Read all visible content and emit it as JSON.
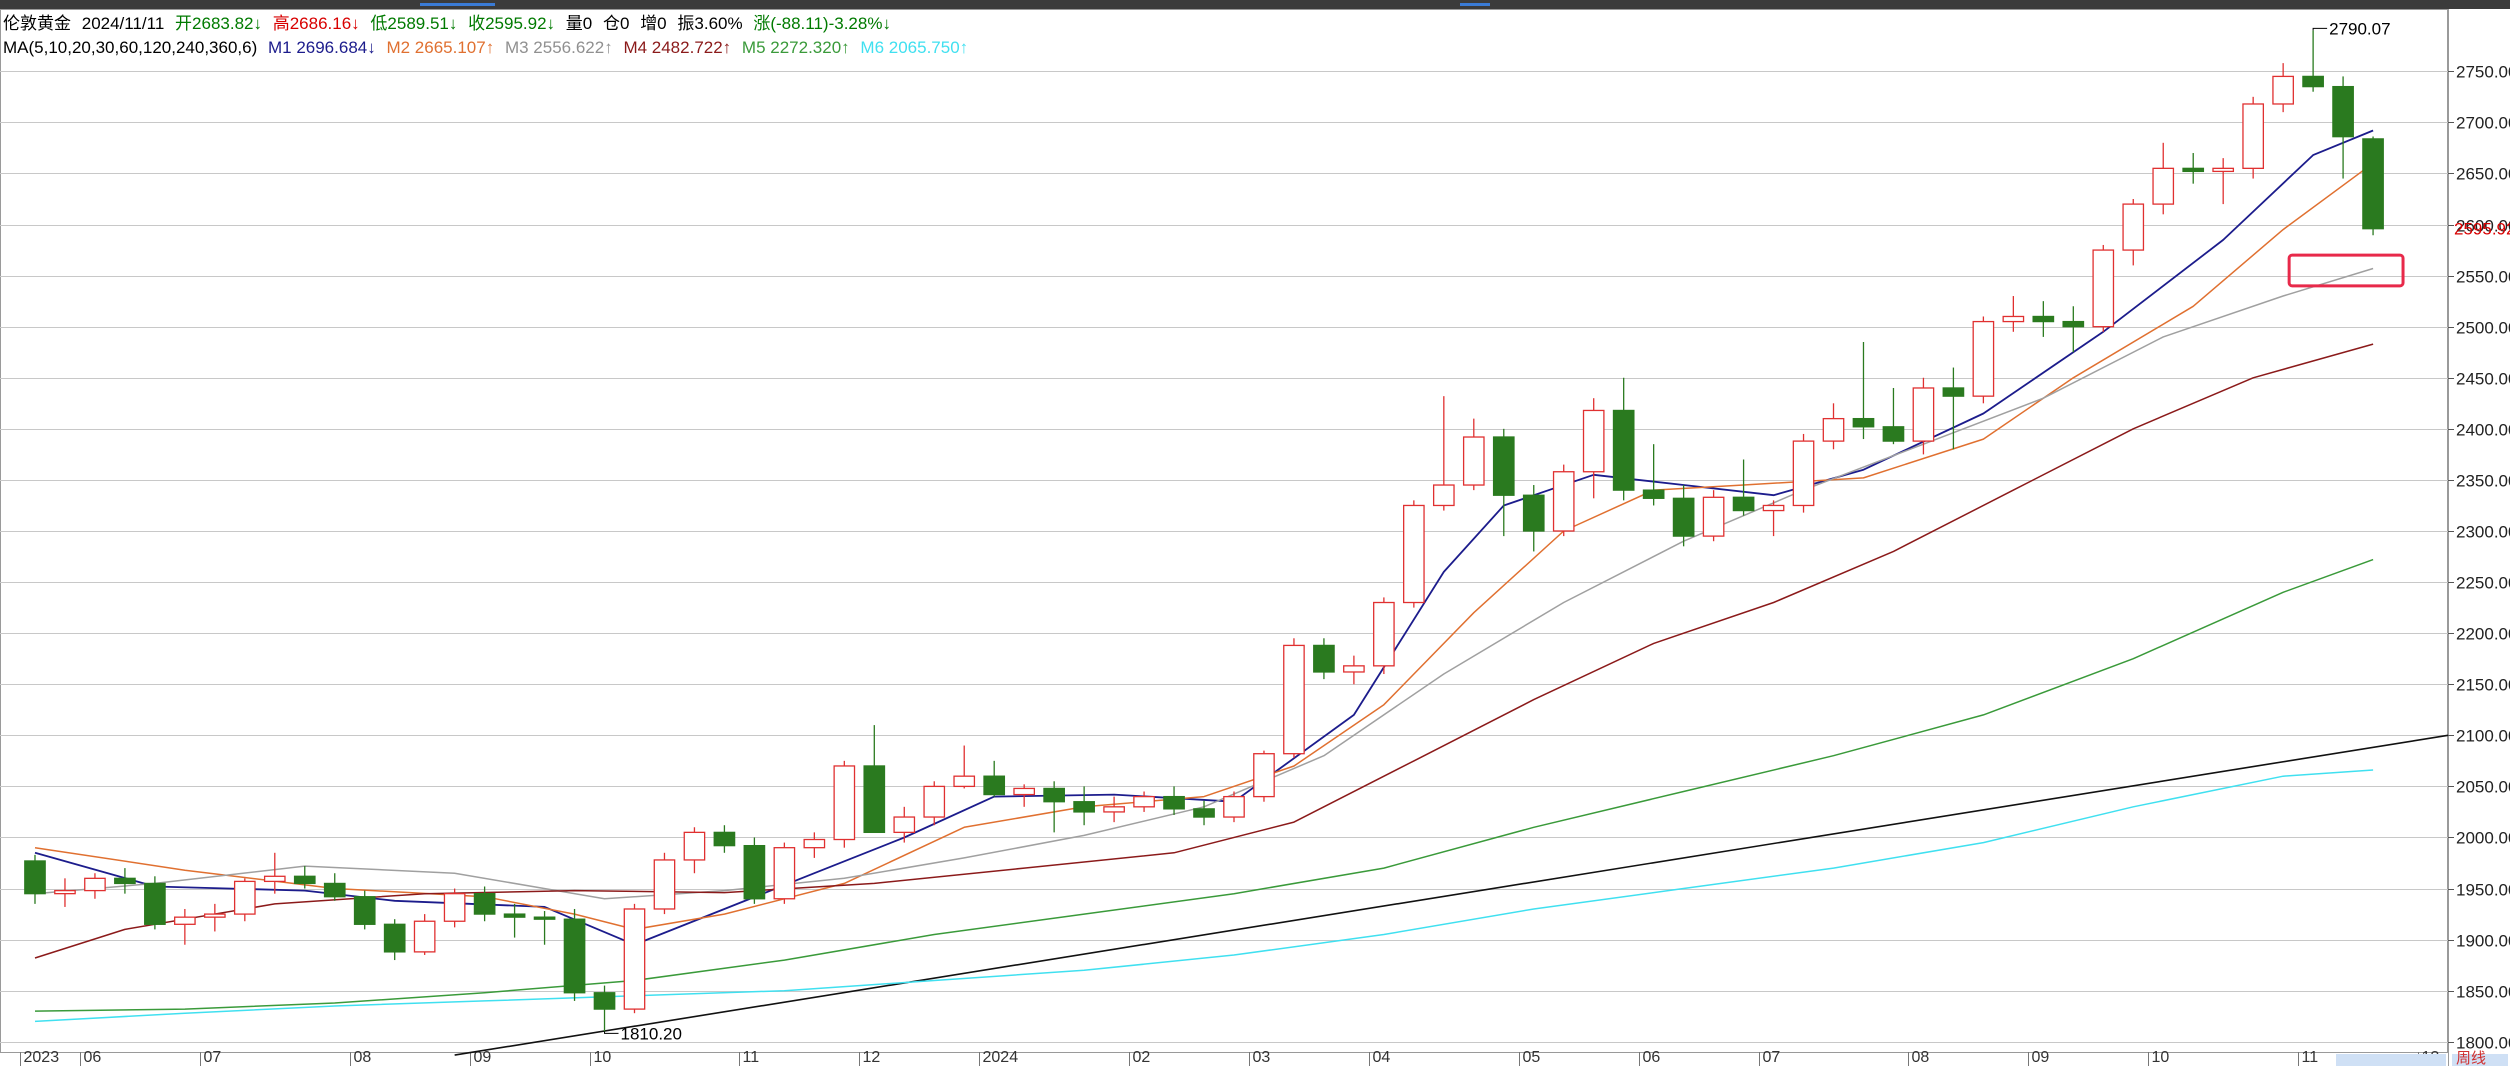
{
  "header": {
    "instrument": "伦敦黄金",
    "date": "2024/11/11",
    "open": "开2683.82↓",
    "high": "高2686.16↓",
    "low": "低2589.51↓",
    "close": "收2595.92↓",
    "volume": "量0",
    "position": "仓0",
    "increase": "增0",
    "amplitude": "振3.60%",
    "change": "涨(-88.11)-3.28%↓"
  },
  "ma_header": {
    "params": "MA(5,10,20,30,60,120,240,360,6)",
    "m1": "M1 2696.684↓",
    "m2": "M2 2665.107↑",
    "m3": "M3 2556.622↑",
    "m4": "M4 2482.722↑",
    "m5": "M5 2272.320↑",
    "m6": "M6 2065.750↑"
  },
  "colors": {
    "up": "#e03030",
    "down": "#2a7a1f",
    "m1": "#1c1c8c",
    "m2": "#e07030",
    "m3": "#a0a0a0",
    "m4": "#8b1a1a",
    "m5": "#3a9a3a",
    "m6": "#40e0f0",
    "grid": "#c8c8c8",
    "trendline": "#111111",
    "highlight": "#e8294a"
  },
  "chart_data": {
    "type": "candlestick",
    "ylim": [
      1790,
      2810
    ],
    "yticks": [
      1800,
      1850,
      1900,
      1950,
      2000,
      2050,
      2100,
      2150,
      2200,
      2250,
      2300,
      2350,
      2400,
      2450,
      2500,
      2550,
      2600,
      2650,
      2700,
      2750
    ],
    "ytick_labels": [
      "1800.00",
      "1850.00",
      "1900.00",
      "1950.00",
      "2000.00",
      "2050.00",
      "2100.00",
      "2150.00",
      "2200.00",
      "2250.00",
      "2300.00",
      "2350.00",
      "2400.00",
      "2450.00",
      "2500.00",
      "2550.00",
      "2600.00",
      "2650.00",
      "2700.00",
      "2750.00"
    ],
    "current_price_label": "2595.92",
    "high_label": "2790.07",
    "low_label": "1810.20",
    "x_labels": [
      {
        "i": 0,
        "label": "2023"
      },
      {
        "i": 2,
        "label": "06"
      },
      {
        "i": 6,
        "label": "07"
      },
      {
        "i": 11,
        "label": "08"
      },
      {
        "i": 15,
        "label": "09"
      },
      {
        "i": 19,
        "label": "10"
      },
      {
        "i": 24,
        "label": "11"
      },
      {
        "i": 28,
        "label": "12"
      },
      {
        "i": 32,
        "label": "2024"
      },
      {
        "i": 37,
        "label": "02"
      },
      {
        "i": 41,
        "label": "03"
      },
      {
        "i": 45,
        "label": "04"
      },
      {
        "i": 50,
        "label": "05"
      },
      {
        "i": 54,
        "label": "06"
      },
      {
        "i": 58,
        "label": "07"
      },
      {
        "i": 63,
        "label": "08"
      },
      {
        "i": 67,
        "label": "09"
      },
      {
        "i": 71,
        "label": "10"
      },
      {
        "i": 76,
        "label": "11"
      },
      {
        "i": 80,
        "label": "12"
      }
    ],
    "period_label": "周线",
    "candles": [
      [
        1977,
        1983,
        1935,
        1945
      ],
      [
        1945,
        1960,
        1932,
        1948
      ],
      [
        1948,
        1965,
        1940,
        1960
      ],
      [
        1960,
        1970,
        1945,
        1955
      ],
      [
        1955,
        1962,
        1910,
        1915
      ],
      [
        1915,
        1930,
        1895,
        1922
      ],
      [
        1922,
        1935,
        1908,
        1925
      ],
      [
        1925,
        1960,
        1918,
        1957
      ],
      [
        1957,
        1985,
        1945,
        1962
      ],
      [
        1962,
        1972,
        1950,
        1955
      ],
      [
        1955,
        1965,
        1938,
        1942
      ],
      [
        1942,
        1948,
        1910,
        1915
      ],
      [
        1915,
        1920,
        1880,
        1888
      ],
      [
        1888,
        1925,
        1885,
        1918
      ],
      [
        1918,
        1950,
        1912,
        1945
      ],
      [
        1945,
        1952,
        1918,
        1925
      ],
      [
        1925,
        1935,
        1902,
        1922
      ],
      [
        1922,
        1928,
        1895,
        1920
      ],
      [
        1920,
        1930,
        1840,
        1848
      ],
      [
        1848,
        1855,
        1810.2,
        1832
      ],
      [
        1832,
        1935,
        1828,
        1930
      ],
      [
        1930,
        1985,
        1925,
        1978
      ],
      [
        1978,
        2010,
        1965,
        2005
      ],
      [
        2005,
        2012,
        1985,
        1992
      ],
      [
        1992,
        2000,
        1935,
        1940
      ],
      [
        1940,
        1995,
        1935,
        1990
      ],
      [
        1990,
        2005,
        1980,
        1998
      ],
      [
        1998,
        2075,
        1990,
        2070
      ],
      [
        2070,
        2110,
        2010,
        2005
      ],
      [
        2005,
        2030,
        1995,
        2020
      ],
      [
        2020,
        2055,
        2012,
        2050
      ],
      [
        2050,
        2090,
        2048,
        2060
      ],
      [
        2060,
        2075,
        2040,
        2042
      ],
      [
        2042,
        2052,
        2030,
        2048
      ],
      [
        2048,
        2055,
        2005,
        2035
      ],
      [
        2035,
        2050,
        2012,
        2025
      ],
      [
        2025,
        2040,
        2015,
        2030
      ],
      [
        2030,
        2045,
        2025,
        2040
      ],
      [
        2040,
        2050,
        2022,
        2028
      ],
      [
        2028,
        2036,
        2012,
        2020
      ],
      [
        2020,
        2045,
        2015,
        2040
      ],
      [
        2040,
        2085,
        2035,
        2082
      ],
      [
        2082,
        2195,
        2078,
        2188
      ],
      [
        2188,
        2195,
        2155,
        2162
      ],
      [
        2162,
        2178,
        2150,
        2168
      ],
      [
        2168,
        2235,
        2160,
        2230
      ],
      [
        2230,
        2330,
        2225,
        2325
      ],
      [
        2325,
        2432,
        2320,
        2345
      ],
      [
        2345,
        2410,
        2340,
        2392
      ],
      [
        2392,
        2400,
        2295,
        2335
      ],
      [
        2335,
        2345,
        2280,
        2300
      ],
      [
        2300,
        2365,
        2295,
        2358
      ],
      [
        2358,
        2430,
        2332,
        2418
      ],
      [
        2418,
        2450,
        2330,
        2340
      ],
      [
        2340,
        2385,
        2325,
        2332
      ],
      [
        2332,
        2345,
        2285,
        2295
      ],
      [
        2295,
        2340,
        2290,
        2333
      ],
      [
        2333,
        2370,
        2315,
        2320
      ],
      [
        2320,
        2330,
        2295,
        2325
      ],
      [
        2325,
        2395,
        2318,
        2388
      ],
      [
        2388,
        2425,
        2380,
        2410
      ],
      [
        2410,
        2485,
        2390,
        2402
      ],
      [
        2402,
        2440,
        2385,
        2388
      ],
      [
        2388,
        2450,
        2375,
        2440
      ],
      [
        2440,
        2460,
        2380,
        2432
      ],
      [
        2432,
        2510,
        2425,
        2505
      ],
      [
        2505,
        2530,
        2495,
        2510
      ],
      [
        2510,
        2525,
        2490,
        2505
      ],
      [
        2505,
        2520,
        2475,
        2500
      ],
      [
        2500,
        2580,
        2495,
        2575
      ],
      [
        2575,
        2625,
        2560,
        2620
      ],
      [
        2620,
        2680,
        2610,
        2655
      ],
      [
        2655,
        2670,
        2640,
        2652
      ],
      [
        2652,
        2665,
        2620,
        2655
      ],
      [
        2655,
        2725,
        2645,
        2718
      ],
      [
        2718,
        2758,
        2710,
        2745
      ],
      [
        2745,
        2790.07,
        2730,
        2735
      ],
      [
        2735,
        2745,
        2645,
        2686
      ],
      [
        2683.82,
        2686.16,
        2589.51,
        2595.92
      ]
    ],
    "ma_series": [
      {
        "name": "M1",
        "points": [
          [
            0,
            1985
          ],
          [
            4,
            1952
          ],
          [
            9,
            1948
          ],
          [
            12,
            1938
          ],
          [
            17,
            1932
          ],
          [
            20,
            1895
          ],
          [
            23,
            1930
          ],
          [
            26,
            1965
          ],
          [
            29,
            2000
          ],
          [
            32,
            2040
          ],
          [
            36,
            2042
          ],
          [
            40,
            2035
          ],
          [
            44,
            2120
          ],
          [
            47,
            2260
          ],
          [
            49,
            2325
          ],
          [
            52,
            2355
          ],
          [
            55,
            2345
          ],
          [
            58,
            2335
          ],
          [
            61,
            2360
          ],
          [
            65,
            2415
          ],
          [
            69,
            2495
          ],
          [
            73,
            2585
          ],
          [
            76,
            2668
          ],
          [
            78,
            2692
          ]
        ]
      },
      {
        "name": "M2",
        "points": [
          [
            0,
            1990
          ],
          [
            5,
            1968
          ],
          [
            10,
            1950
          ],
          [
            15,
            1942
          ],
          [
            18,
            1925
          ],
          [
            20,
            1910
          ],
          [
            23,
            1925
          ],
          [
            27,
            1955
          ],
          [
            31,
            2010
          ],
          [
            35,
            2030
          ],
          [
            39,
            2040
          ],
          [
            42,
            2070
          ],
          [
            45,
            2130
          ],
          [
            48,
            2220
          ],
          [
            51,
            2300
          ],
          [
            54,
            2340
          ],
          [
            57,
            2345
          ],
          [
            61,
            2352
          ],
          [
            65,
            2390
          ],
          [
            68,
            2450
          ],
          [
            72,
            2520
          ],
          [
            75,
            2595
          ],
          [
            78,
            2660
          ]
        ]
      },
      {
        "name": "M3",
        "points": [
          [
            0,
            1945
          ],
          [
            4,
            1955
          ],
          [
            9,
            1972
          ],
          [
            14,
            1965
          ],
          [
            19,
            1940
          ],
          [
            23,
            1948
          ],
          [
            27,
            1960
          ],
          [
            31,
            1980
          ],
          [
            35,
            2002
          ],
          [
            39,
            2030
          ],
          [
            43,
            2080
          ],
          [
            47,
            2160
          ],
          [
            51,
            2230
          ],
          [
            55,
            2290
          ],
          [
            59,
            2340
          ],
          [
            63,
            2385
          ],
          [
            67,
            2430
          ],
          [
            71,
            2490
          ],
          [
            75,
            2530
          ],
          [
            78,
            2557
          ]
        ]
      },
      {
        "name": "M4",
        "points": [
          [
            0,
            1882
          ],
          [
            3,
            1910
          ],
          [
            8,
            1935
          ],
          [
            13,
            1945
          ],
          [
            18,
            1948
          ],
          [
            23,
            1946
          ],
          [
            28,
            1955
          ],
          [
            33,
            1970
          ],
          [
            38,
            1985
          ],
          [
            42,
            2015
          ],
          [
            46,
            2075
          ],
          [
            50,
            2135
          ],
          [
            54,
            2190
          ],
          [
            58,
            2230
          ],
          [
            62,
            2280
          ],
          [
            66,
            2340
          ],
          [
            70,
            2400
          ],
          [
            74,
            2450
          ],
          [
            78,
            2483
          ]
        ]
      },
      {
        "name": "M5",
        "points": [
          [
            0,
            1830
          ],
          [
            5,
            1832
          ],
          [
            10,
            1838
          ],
          [
            15,
            1848
          ],
          [
            20,
            1860
          ],
          [
            25,
            1880
          ],
          [
            30,
            1905
          ],
          [
            35,
            1925
          ],
          [
            40,
            1945
          ],
          [
            45,
            1970
          ],
          [
            50,
            2010
          ],
          [
            55,
            2045
          ],
          [
            60,
            2080
          ],
          [
            65,
            2120
          ],
          [
            70,
            2175
          ],
          [
            75,
            2240
          ],
          [
            78,
            2272
          ]
        ]
      },
      {
        "name": "M6",
        "points": [
          [
            0,
            1820
          ],
          [
            5,
            1828
          ],
          [
            10,
            1835
          ],
          [
            15,
            1840
          ],
          [
            20,
            1845
          ],
          [
            25,
            1850
          ],
          [
            30,
            1860
          ],
          [
            35,
            1870
          ],
          [
            40,
            1885
          ],
          [
            45,
            1905
          ],
          [
            50,
            1930
          ],
          [
            55,
            1950
          ],
          [
            60,
            1970
          ],
          [
            65,
            1995
          ],
          [
            70,
            2030
          ],
          [
            75,
            2060
          ],
          [
            78,
            2066
          ]
        ]
      }
    ],
    "trendline": {
      "from": [
        14,
        1787
      ],
      "to": [
        82,
        2100
      ]
    },
    "highlight_box": {
      "x0": 75.7,
      "x1": 79.5,
      "y_top": 2570,
      "y_bottom": 2540
    }
  }
}
